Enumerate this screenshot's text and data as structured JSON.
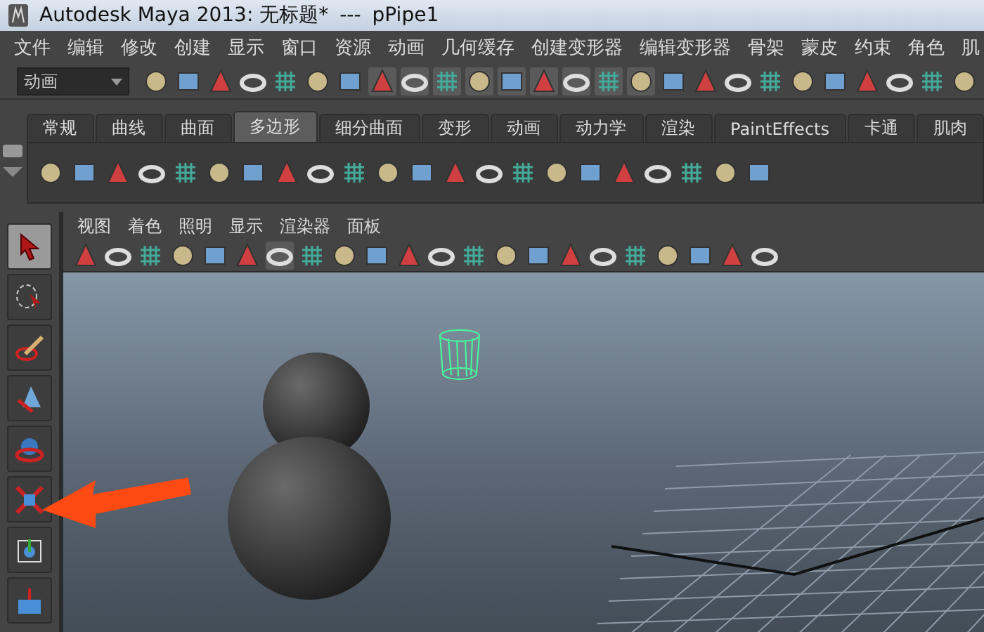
{
  "window": {
    "title": "Autodesk Maya 2013: 无标题*",
    "separator": "---",
    "selection": "pPipe1"
  },
  "menu": [
    "文件",
    "编辑",
    "修改",
    "创建",
    "显示",
    "窗口",
    "资源",
    "动画",
    "几何缓存",
    "创建变形器",
    "编辑变形器",
    "骨架",
    "蒙皮",
    "约束",
    "角色",
    "肌"
  ],
  "mode_dropdown": {
    "value": "动画"
  },
  "shelf_tabs": [
    {
      "label": "常规",
      "selected": false
    },
    {
      "label": "曲线",
      "selected": false
    },
    {
      "label": "曲面",
      "selected": false
    },
    {
      "label": "多边形",
      "selected": true
    },
    {
      "label": "细分曲面",
      "selected": false
    },
    {
      "label": "变形",
      "selected": false
    },
    {
      "label": "动画",
      "selected": false
    },
    {
      "label": "动力学",
      "selected": false
    },
    {
      "label": "渲染",
      "selected": false
    },
    {
      "label": "PaintEffects",
      "selected": false
    },
    {
      "label": "卡通",
      "selected": false
    },
    {
      "label": "肌肉",
      "selected": false
    }
  ],
  "panel_menu": [
    "视图",
    "着色",
    "照明",
    "显示",
    "渲染器",
    "面板"
  ],
  "toolbox": [
    {
      "kind": "select",
      "selected": true
    },
    {
      "kind": "lasso",
      "selected": false
    },
    {
      "kind": "paint",
      "selected": false
    },
    {
      "kind": "move",
      "selected": false
    },
    {
      "kind": "rotate",
      "selected": false
    },
    {
      "kind": "scale",
      "selected": false
    },
    {
      "kind": "manip",
      "selected": false
    },
    {
      "kind": "soft",
      "selected": false
    }
  ]
}
